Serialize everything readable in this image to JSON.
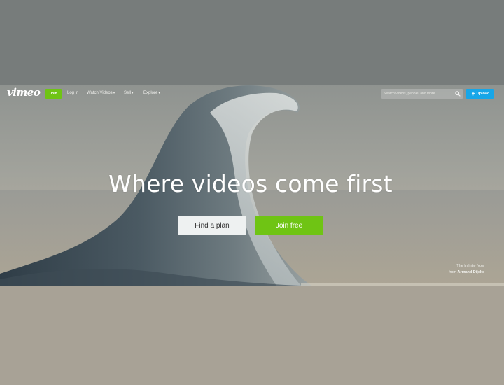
{
  "nav": {
    "logo": "vimeo",
    "join_label": "Join",
    "login_label": "Log in",
    "links": [
      "Watch Videos",
      "Sell",
      "Explore"
    ],
    "search_placeholder": "Search videos, people, and more",
    "upload_label": "Upload"
  },
  "hero": {
    "headline": "Where videos come first",
    "find_plan_label": "Find a plan",
    "join_free_label": "Join free",
    "credit_title": "The Infinite Now",
    "credit_by": "from",
    "credit_author": "Armand Dijcks"
  },
  "colors": {
    "accent_green": "#6fc414",
    "upload_blue": "#17a6e8"
  },
  "icons": [
    "search-icon",
    "upload-icon",
    "chevron-down-icon"
  ]
}
